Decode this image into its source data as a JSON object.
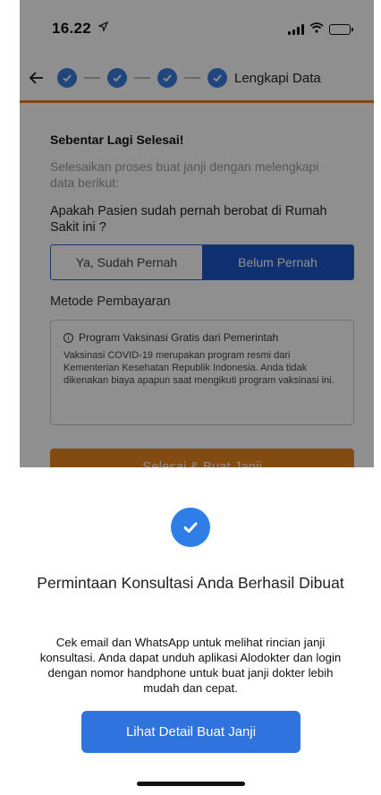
{
  "status_bar": {
    "time": "16.22",
    "location_icon": "location-arrow-icon",
    "signal_icon": "cellular-signal-icon",
    "wifi_icon": "wifi-icon",
    "battery_icon": "battery-icon",
    "battery_level": 0.45
  },
  "stepper": {
    "back_icon": "back-arrow-icon",
    "completed_icon": "check-icon",
    "current_step_label": "Lengkapi Data"
  },
  "form": {
    "title": "Sebentar Lagi Selesai!",
    "subtitle": "Selesaikan proses buat janji dengan melengkapi data berikut:",
    "question": "Apakah Pasien sudah pernah berobat di Rumah Sakit ini ?",
    "option_yes": "Ya, Sudah Pernah",
    "option_no": "Belum Pernah",
    "payment_label": "Metode Pembayaran",
    "info_title": "Program Vaksinasi Gratis dari Pemerintah",
    "info_body": "Vaksinasi COVID-19 merupakan program resmi dari Kementerian Kesehatan Republik Indonesia. Anda tidak dikenakan biaya apapun saat mengikuti program vaksinasi ini.",
    "submit_label": "Selesai & Buat Janji"
  },
  "sheet": {
    "success_icon": "check-circle-icon",
    "title": "Permintaan Konsultasi Anda Berhasil Dibuat",
    "body": "Cek email dan WhatsApp untuk melihat rincian janji konsultasi. Anda dapat unduh aplikasi Alodokter dan login dengan nomor handphone untuk buat janji dokter lebih mudah dan cepat.",
    "button_label": "Lihat Detail Buat Janji"
  },
  "colors": {
    "primary_blue": "#2f73de",
    "accent_orange": "#e8861f"
  }
}
